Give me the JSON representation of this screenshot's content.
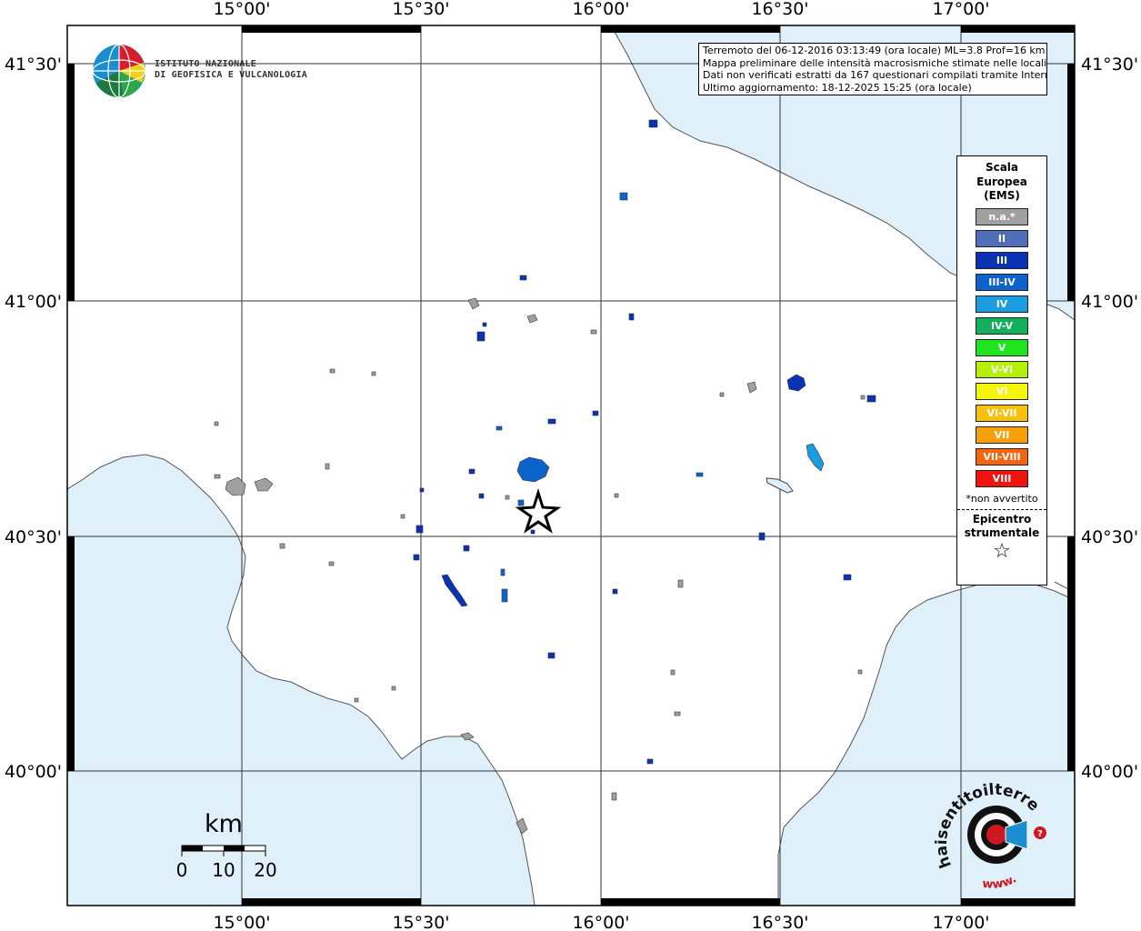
{
  "map": {
    "lon_ticks": [
      "15°00'",
      "15°30'",
      "16°00'",
      "16°30'",
      "17°00'"
    ],
    "lat_ticks": [
      "41°30'",
      "41°00'",
      "40°30'",
      "40°00'"
    ],
    "land_color": "#ffffff",
    "sea_color": "#dff0fb"
  },
  "info": {
    "line1": "Terremoto del 06-12-2016 03:13:49 (ora locale) ML=3.8 Prof=16 km",
    "line2": "Mappa preliminare delle intensità macrosismiche stimate nelle località",
    "line3": "Dati non verificati estratti da 167 questionari compilati tramite Internet.",
    "line4": "Ultimo aggiornamento: 18-12-2025 15:25 (ora locale)"
  },
  "logo": {
    "line1": "ISTITUTO NAZIONALE",
    "line2": "DI GEOFISICA E VULCANOLOGIA"
  },
  "legend": {
    "title1": "Scala",
    "title2": "Europea",
    "title3": "(EMS)",
    "items": [
      {
        "label": "n.a.*",
        "color": "#a0a0a0"
      },
      {
        "label": "II",
        "color": "#4f6db8"
      },
      {
        "label": "III",
        "color": "#0a32b5"
      },
      {
        "label": "III-IV",
        "color": "#0c63cc"
      },
      {
        "label": "IV",
        "color": "#1a9ee0"
      },
      {
        "label": "IV-V",
        "color": "#13b05b"
      },
      {
        "label": "V",
        "color": "#1fe51f"
      },
      {
        "label": "V-VI",
        "color": "#b6f006"
      },
      {
        "label": "VI",
        "color": "#f5f50a"
      },
      {
        "label": "VI-VII",
        "color": "#f7c10b"
      },
      {
        "label": "VII",
        "color": "#f7a20d"
      },
      {
        "label": "VII-VIII",
        "color": "#f5650f"
      },
      {
        "label": "VIII",
        "color": "#ef1410"
      }
    ],
    "note": "*non avvertito",
    "epi1": "Epicentro",
    "epi2": "strumentale",
    "star": "☆"
  },
  "scale": {
    "unit": "km",
    "labels": [
      "0",
      "10",
      "20"
    ]
  },
  "badge": {
    "text": "haisentitoilterremoto.it",
    "url": "www."
  }
}
